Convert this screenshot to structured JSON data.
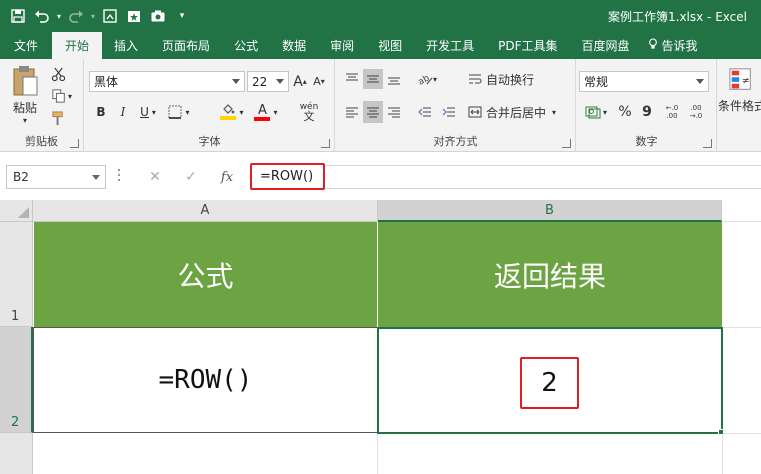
{
  "window": {
    "title": "案例工作簿1.xlsx - Excel"
  },
  "tabs": [
    {
      "label": "文件"
    },
    {
      "label": "开始"
    },
    {
      "label": "插入"
    },
    {
      "label": "页面布局"
    },
    {
      "label": "公式"
    },
    {
      "label": "数据"
    },
    {
      "label": "审阅"
    },
    {
      "label": "视图"
    },
    {
      "label": "开发工具"
    },
    {
      "label": "PDF工具集"
    },
    {
      "label": "百度网盘"
    },
    {
      "label": "告诉我"
    }
  ],
  "ribbon": {
    "clipboard": {
      "paste_label": "粘贴",
      "group_label": "剪贴板"
    },
    "font": {
      "font_name": "黑体",
      "font_size": "22",
      "group_label": "字体",
      "bold": "B",
      "italic": "I",
      "underline": "U",
      "grow": "A",
      "shrink": "A",
      "phonetic": "wén",
      "font_color": "A"
    },
    "alignment": {
      "wrap_text": "自动换行",
      "merge_center": "合并后居中",
      "group_label": "对齐方式"
    },
    "number": {
      "format": "常规",
      "percent": "%",
      "comma": "9",
      "group_label": "数字"
    },
    "styles": {
      "conditional_format": "条件格式"
    }
  },
  "formula_bar": {
    "name_box": "B2",
    "cancel": "✕",
    "enter": "✓",
    "fx": "fx",
    "formula": "=ROW()"
  },
  "grid": {
    "columns": [
      {
        "label": "A"
      },
      {
        "label": "B"
      }
    ],
    "rows": [
      {
        "label": "1"
      },
      {
        "label": "2"
      }
    ],
    "header_cells": [
      "公式",
      "返回结果"
    ],
    "body_cells": [
      "=ROW()",
      "2"
    ]
  },
  "colors": {
    "excel_green": "#217346",
    "header_fill": "#6ca443",
    "highlight_red": "#e02020"
  }
}
